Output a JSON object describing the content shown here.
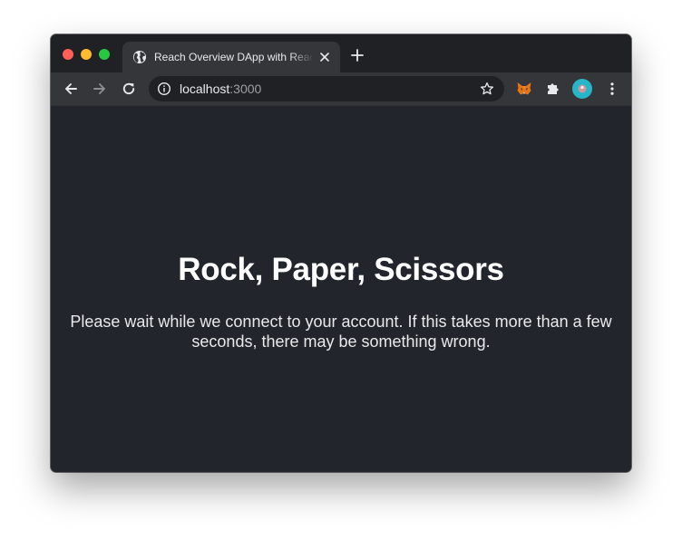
{
  "browser": {
    "tab": {
      "title": "Reach Overview DApp with React",
      "favicon": "globe-icon",
      "close": "close-icon"
    },
    "new_tab": "plus-icon",
    "toolbar": {
      "back": "back-arrow-icon",
      "forward": "forward-arrow-icon",
      "reload": "reload-icon",
      "address": {
        "host": "localhost",
        "port": ":3000",
        "info": "info-icon",
        "bookmark": "star-icon"
      },
      "extensions": [
        "metamask-fox-icon",
        "puzzle-icon"
      ],
      "profile": "avatar",
      "menu": "kebab-menu-icon"
    },
    "colors": {
      "chrome_dark": "#202124",
      "toolbar": "#35363a",
      "page_bg": "#23252d",
      "text_light": "#ffffff",
      "avatar": "#27b6c9"
    }
  },
  "page": {
    "heading": "Rock, Paper, Scissors",
    "message": "Please wait while we connect to your account. If this takes more than a few seconds, there may be something wrong."
  }
}
